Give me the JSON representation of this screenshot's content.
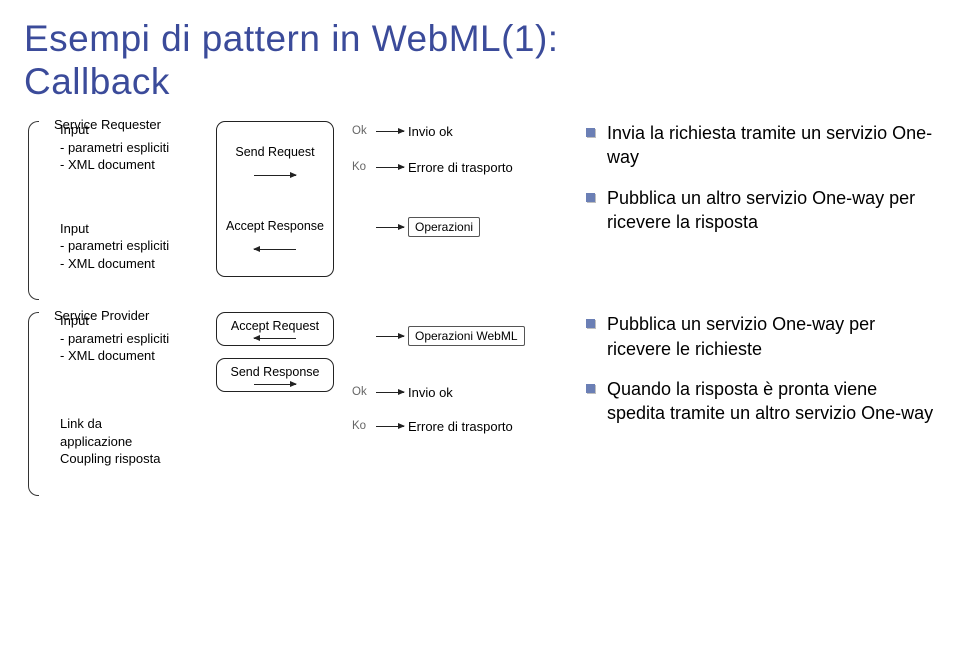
{
  "title_line1": "Esempi di pattern in WebML(1):",
  "title_line2": "Callback",
  "requester": {
    "section": "Service Requester",
    "input1": {
      "head": "Input",
      "l1": "- parametri espliciti",
      "l2": "- XML document"
    },
    "input2": {
      "head": "Input",
      "l1": "- parametri espliciti",
      "l2": "- XML document"
    },
    "op1": "Send Request",
    "op2": "Accept Response",
    "ok": "Ok",
    "ko": "Ko",
    "invio_ok": "Invio ok",
    "errore": "Errore di trasporto",
    "operazioni": "Operazioni",
    "bullet1": "Invia la richiesta tramite un servizio One-way",
    "bullet2": "Pubblica un altro servizio One-way per ricevere la risposta"
  },
  "provider": {
    "section": "Service Provider",
    "input": {
      "head": "Input",
      "l1": "- parametri espliciti",
      "l2": "- XML document"
    },
    "link": {
      "head": "Link da",
      "l1": "applicazione",
      "l2": "Coupling risposta"
    },
    "op1": "Accept Request",
    "op2": "Send Response",
    "ok": "Ok",
    "ko": "Ko",
    "invio_ok": "Invio ok",
    "errore": "Errore di trasporto",
    "operazioni": "Operazioni WebML",
    "bullet1": "Pubblica un servizio One-way per ricevere le richieste",
    "bullet2": "Quando la risposta è pronta viene spedita tramite un altro servizio One-way"
  }
}
